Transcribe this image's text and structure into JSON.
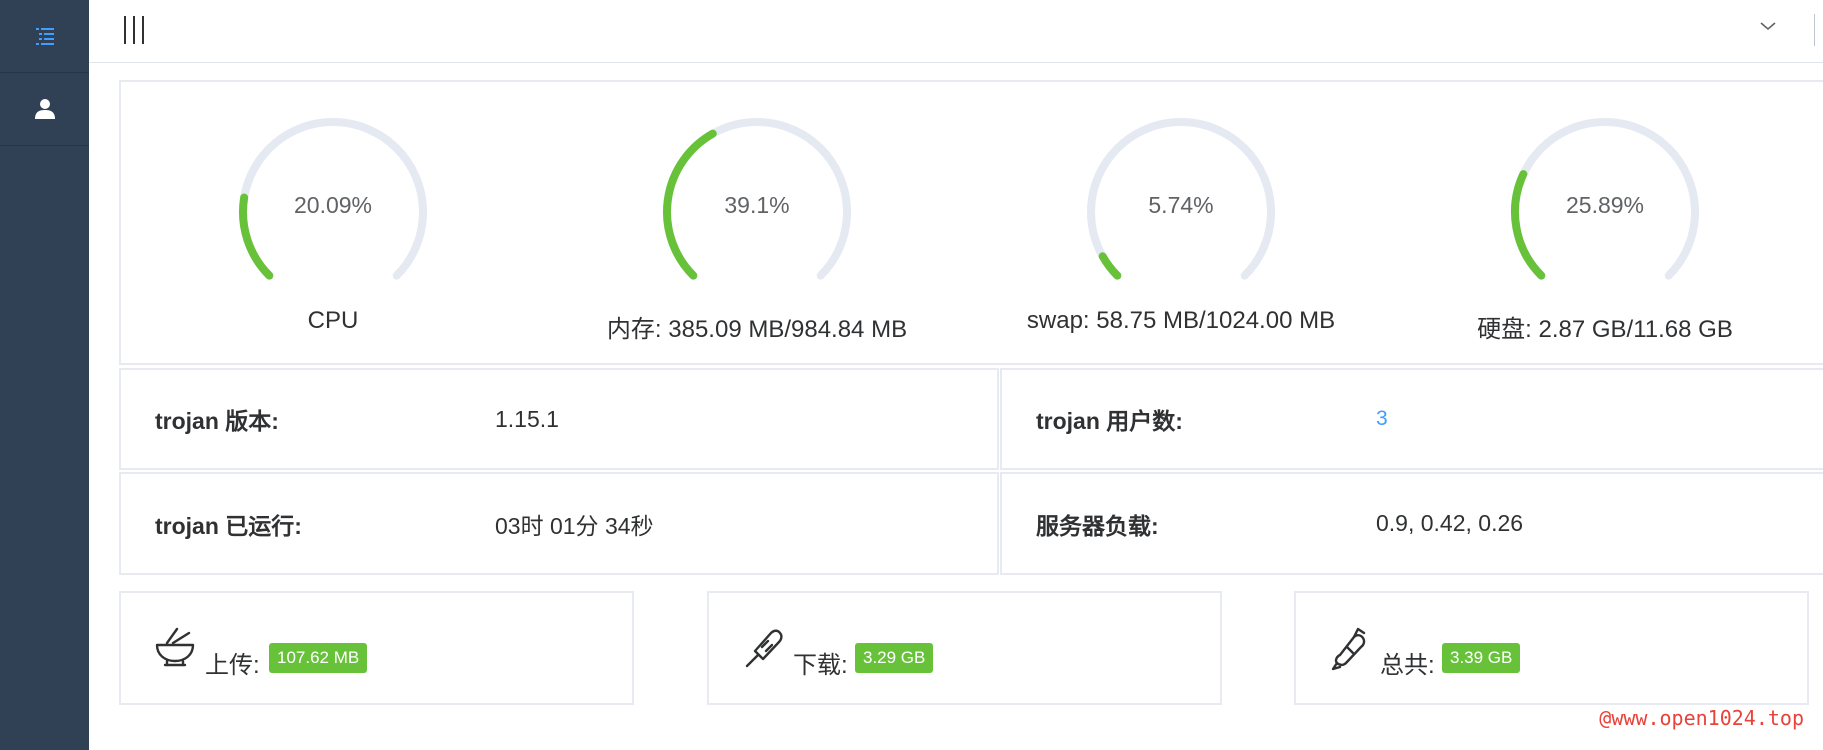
{
  "colors": {
    "sidebar_bg": "#304156",
    "accent": "#409eff",
    "success": "#67c23a",
    "gauge_track": "#e5e9f2",
    "watermark": "#e8423a"
  },
  "sidebar": {
    "items": [
      {
        "icon": "menu-list-icon",
        "active": true
      },
      {
        "icon": "user-icon",
        "active": false
      }
    ]
  },
  "topbar": {
    "menu_icon": "hamburger-icon",
    "dropdown_icon": "chevron-down-icon"
  },
  "gauges": [
    {
      "value_text": "20.09%",
      "percent": 20.09,
      "label": "CPU"
    },
    {
      "value_text": "39.1%",
      "percent": 39.1,
      "label": "内存: 385.09 MB/984.84 MB"
    },
    {
      "value_text": "5.74%",
      "percent": 5.74,
      "label": "swap: 58.75 MB/1024.00 MB"
    },
    {
      "value_text": "25.89%",
      "percent": 25.89,
      "label": "硬盘: 2.87 GB/11.68 GB"
    }
  ],
  "info": {
    "version_label": "trojan 版本:",
    "version_value": "1.15.1",
    "users_label": "trojan 用户数:",
    "users_value": "3",
    "uptime_label": "trojan 已运行:",
    "uptime_value": "03时 01分 34秒",
    "load_label": "服务器负载:",
    "load_value": "0.9, 0.42, 0.26"
  },
  "traffic": {
    "upload_icon": "bowl-icon",
    "upload_label": "上传:",
    "upload_value": "107.62 MB",
    "download_icon": "popsicle-icon",
    "download_label": "下载:",
    "download_value": "3.29 GB",
    "total_icon": "candy-icon",
    "total_label": "总共:",
    "total_value": "3.39 GB"
  },
  "watermark": "@www.open1024.top"
}
